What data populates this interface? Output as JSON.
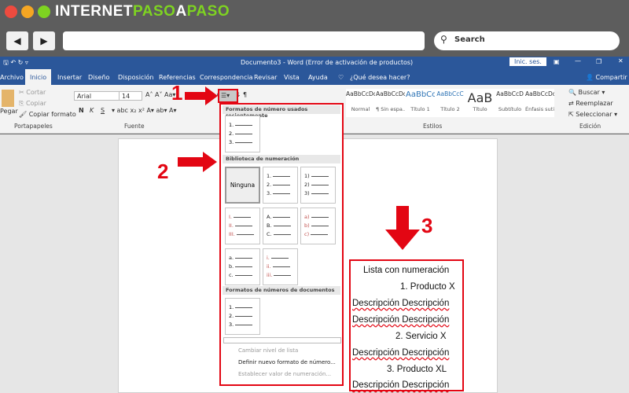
{
  "browser": {
    "logo": "INTERNETPASOAPASO",
    "logo_pre": "INTERNET",
    "logo_mid": "PASO",
    "logo_a": "A",
    "logo_post": "PASO",
    "search_placeholder": "Search",
    "back": "◀",
    "forward": "▶"
  },
  "word": {
    "title": "Documento3 - Word (Error de activación de productos)",
    "signin": "Inic. ses.",
    "tabs": [
      "Archivo",
      "Inicio",
      "Insertar",
      "Diseño",
      "Disposición",
      "Referencias",
      "Correspondencia",
      "Revisar",
      "Vista",
      "Ayuda"
    ],
    "tell_me": "¿Qué desea hacer?",
    "share": "Compartir",
    "clipboard": {
      "paste": "Pegar",
      "cut": "Cortar",
      "copy": "Copiar",
      "format_painter": "Copiar formato",
      "label": "Portapapeles"
    },
    "font": {
      "name": "Arial",
      "size": "14",
      "label": "Fuente",
      "bold": "N",
      "italic": "K",
      "underline": "S"
    },
    "styles": {
      "label": "Estilos",
      "items": [
        {
          "preview": "AaBbCcDc",
          "name": "Normal"
        },
        {
          "preview": "AaBbCcDc",
          "name": "¶ Sin espa..."
        },
        {
          "preview": "AaBbCc",
          "name": "Título 1"
        },
        {
          "preview": "AaBbCcC",
          "name": "Título 2"
        },
        {
          "preview": "AaB",
          "name": "Título"
        },
        {
          "preview": "AaBbCcD",
          "name": "Subtítulo"
        },
        {
          "preview": "AaBbCcDc",
          "name": "Énfasis sutil"
        }
      ]
    },
    "editing": {
      "find": "Buscar",
      "replace": "Reemplazar",
      "select": "Seleccionar",
      "label": "Edición"
    }
  },
  "numbering_menu": {
    "recent_header": "Formatos de número usados recientemente",
    "library_header": "Biblioteca de numeración",
    "none": "Ninguna",
    "document_header": "Formatos de números de documentos",
    "formats": [
      [
        "1.",
        "2.",
        "3."
      ],
      [
        "1)",
        "2)",
        "3)"
      ],
      [
        "I.",
        "II.",
        "III."
      ],
      [
        "A.",
        "B.",
        "C."
      ],
      [
        "a)",
        "b)",
        "c)"
      ],
      [
        "a.",
        "b.",
        "c."
      ],
      [
        "i.",
        "ii.",
        "iii."
      ]
    ],
    "change_level": "Cambiar nivel de lista",
    "define_new": "Definir nuevo formato de número...",
    "set_value": "Establecer valor de numeración..."
  },
  "document": {
    "lines": [
      "Lista con numeración",
      "1.  Producto X",
      "Descripción Descripción",
      "Descripción Descripción",
      "2.  Servicio X",
      "Descripción Descripción",
      "3.  Producto XL",
      "Descripción Descripción"
    ]
  },
  "callouts": [
    "1",
    "2",
    "3"
  ],
  "colors": {
    "word_blue": "#2b579a",
    "callout_red": "#e30613"
  }
}
